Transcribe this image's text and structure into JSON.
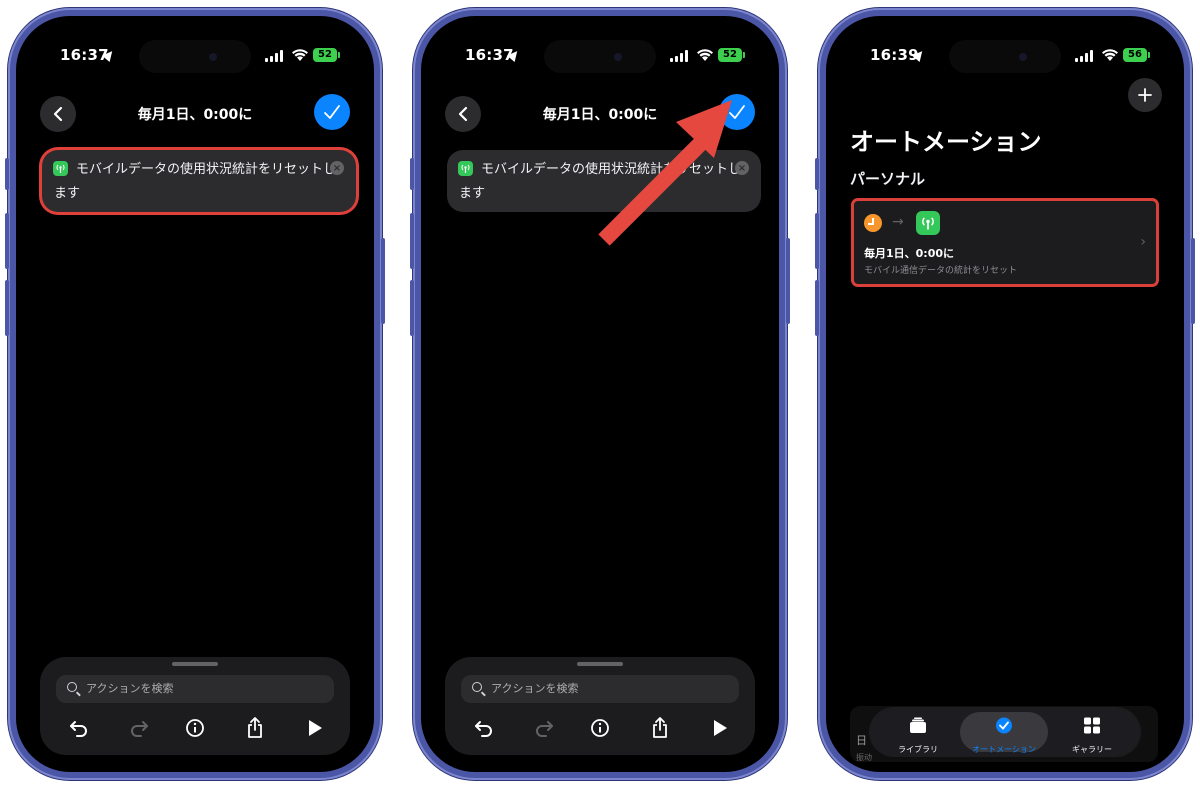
{
  "colors": {
    "accent": "#0a84ff",
    "highlight": "#e0403a",
    "cellular_green": "#34c759",
    "clock_orange": "#f7962d"
  },
  "phones": [
    {
      "status": {
        "time": "16:37",
        "battery": "52"
      },
      "nav": {
        "title": "毎月1日、0:00に"
      },
      "action": {
        "text": "モバイルデータの使用状況統計をリセットします"
      },
      "search": {
        "placeholder": "アクションを検索"
      }
    },
    {
      "status": {
        "time": "16:37",
        "battery": "52"
      },
      "nav": {
        "title": "毎月1日、0:00に"
      },
      "action": {
        "text": "モバイルデータの使用状況統計をリセットします"
      },
      "search": {
        "placeholder": "アクションを検索"
      }
    },
    {
      "status": {
        "time": "16:39",
        "battery": "56"
      },
      "title": "オートメーション",
      "section": "パーソナル",
      "automation": {
        "trigger": "毎月1日、0:00に",
        "subtitle": "モバイル通信データの統計をリセット"
      },
      "behind": {
        "line1": "日",
        "line2": "振动"
      },
      "tabs": [
        {
          "label": "ライブラリ",
          "icon": "library-icon"
        },
        {
          "label": "オートメーション",
          "icon": "automation-icon"
        },
        {
          "label": "ギャラリー",
          "icon": "gallery-icon"
        }
      ]
    }
  ]
}
